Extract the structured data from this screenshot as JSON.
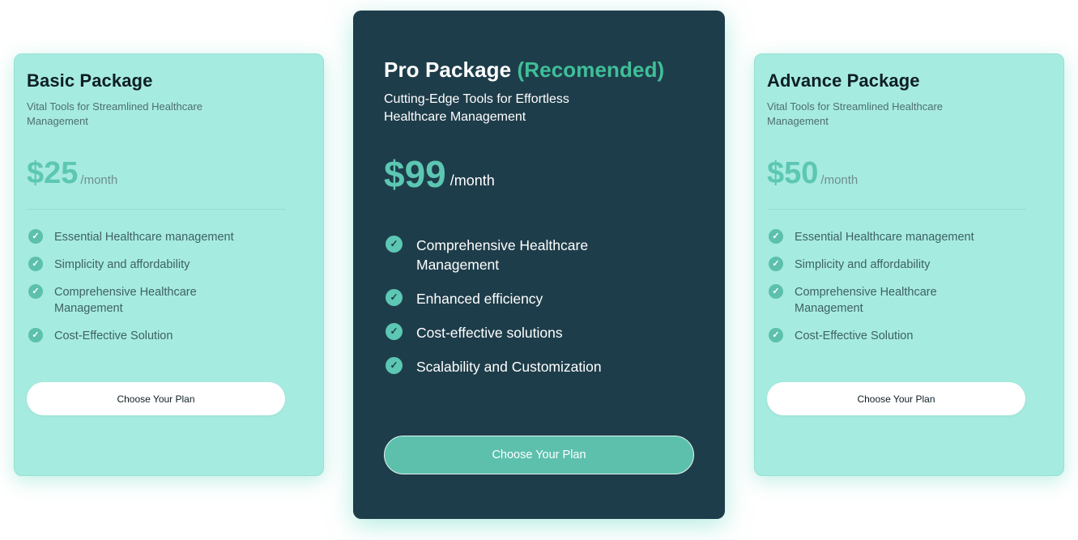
{
  "basic": {
    "title": "Basic Package",
    "subtitle": "Vital Tools for Streamlined Healthcare Management",
    "price": "$25",
    "period": "/month",
    "features": [
      "Essential Healthcare management",
      "Simplicity and affordability",
      "Comprehensive Healthcare Management",
      "Cost-Effective Solution"
    ],
    "button_label": "Choose Your Plan"
  },
  "pro": {
    "title": "Pro Package",
    "title_accent": "(Recomended)",
    "subtitle": "Cutting-Edge Tools for Effortless Healthcare Management",
    "price": "$99",
    "period": "/month",
    "features": [
      "Comprehensive Healthcare Management",
      "Enhanced efficiency",
      "Cost-effective solutions",
      "Scalability and Customization"
    ],
    "button_label": "Choose Your Plan"
  },
  "advance": {
    "title": "Advance Package",
    "subtitle": "Vital Tools for Streamlined Healthcare Management",
    "price": "$50",
    "period": "/month",
    "features": [
      "Essential Healthcare management",
      "Simplicity and affordability",
      "Comprehensive Healthcare Management",
      "Cost-Effective Solution"
    ],
    "button_label": "Choose Your Plan"
  },
  "icons": {
    "check": "check-circle-icon"
  },
  "colors": {
    "light_card": "#a6ebdf",
    "dark_card": "#1e3d4a",
    "accent": "#3fbf98",
    "price": "#5cc7b3"
  }
}
